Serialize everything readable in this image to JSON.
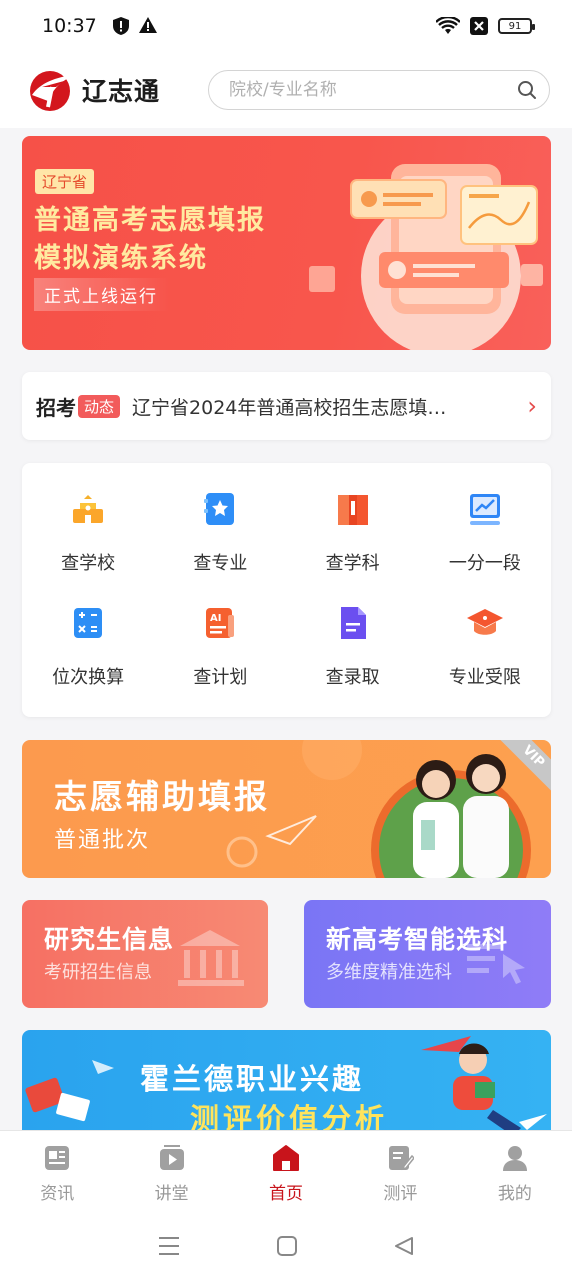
{
  "status": {
    "time": "10:37",
    "battery": "91"
  },
  "app": {
    "name": "辽志通"
  },
  "search": {
    "placeholder": "院校/专业名称"
  },
  "banner": {
    "province": "辽宁省",
    "title_line1": "普通高考志愿填报",
    "title_line2": "模拟演练系统",
    "subtitle": "正式上线运行"
  },
  "news": {
    "label": "招考",
    "tag": "动态",
    "headline": "辽宁省2024年普通高校招生志愿填…"
  },
  "grid": {
    "items": [
      {
        "label": "查学校",
        "icon": "school-icon"
      },
      {
        "label": "查专业",
        "icon": "major-icon"
      },
      {
        "label": "查学科",
        "icon": "subject-book-icon"
      },
      {
        "label": "一分一段",
        "icon": "chart-icon"
      },
      {
        "label": "位次换算",
        "icon": "calculator-icon"
      },
      {
        "label": "查计划",
        "icon": "ai-plan-icon"
      },
      {
        "label": "查录取",
        "icon": "document-icon"
      },
      {
        "label": "专业受限",
        "icon": "graduation-cap-icon"
      }
    ]
  },
  "aid": {
    "title": "志愿辅助填报",
    "subtitle": "普通批次",
    "badge": "VIP"
  },
  "cards": {
    "left": {
      "title": "研究生信息",
      "subtitle": "考研招生信息"
    },
    "right": {
      "title": "新高考智能选科",
      "subtitle": "多维度精准选科"
    }
  },
  "holland": {
    "line1": "霍兰德职业兴趣",
    "line2": "测评价值分析"
  },
  "tabs": [
    {
      "label": "资讯",
      "icon": "news-icon",
      "active": false
    },
    {
      "label": "讲堂",
      "icon": "video-icon",
      "active": false
    },
    {
      "label": "首页",
      "icon": "home-icon",
      "active": true
    },
    {
      "label": "测评",
      "icon": "assessment-icon",
      "active": false
    },
    {
      "label": "我的",
      "icon": "profile-icon",
      "active": false
    }
  ],
  "colors": {
    "brand_red": "#c8141b",
    "banner_red": "#f65148",
    "orange": "#fc9a4e",
    "purple": "#7a75f5",
    "blue": "#2aa3ee"
  }
}
